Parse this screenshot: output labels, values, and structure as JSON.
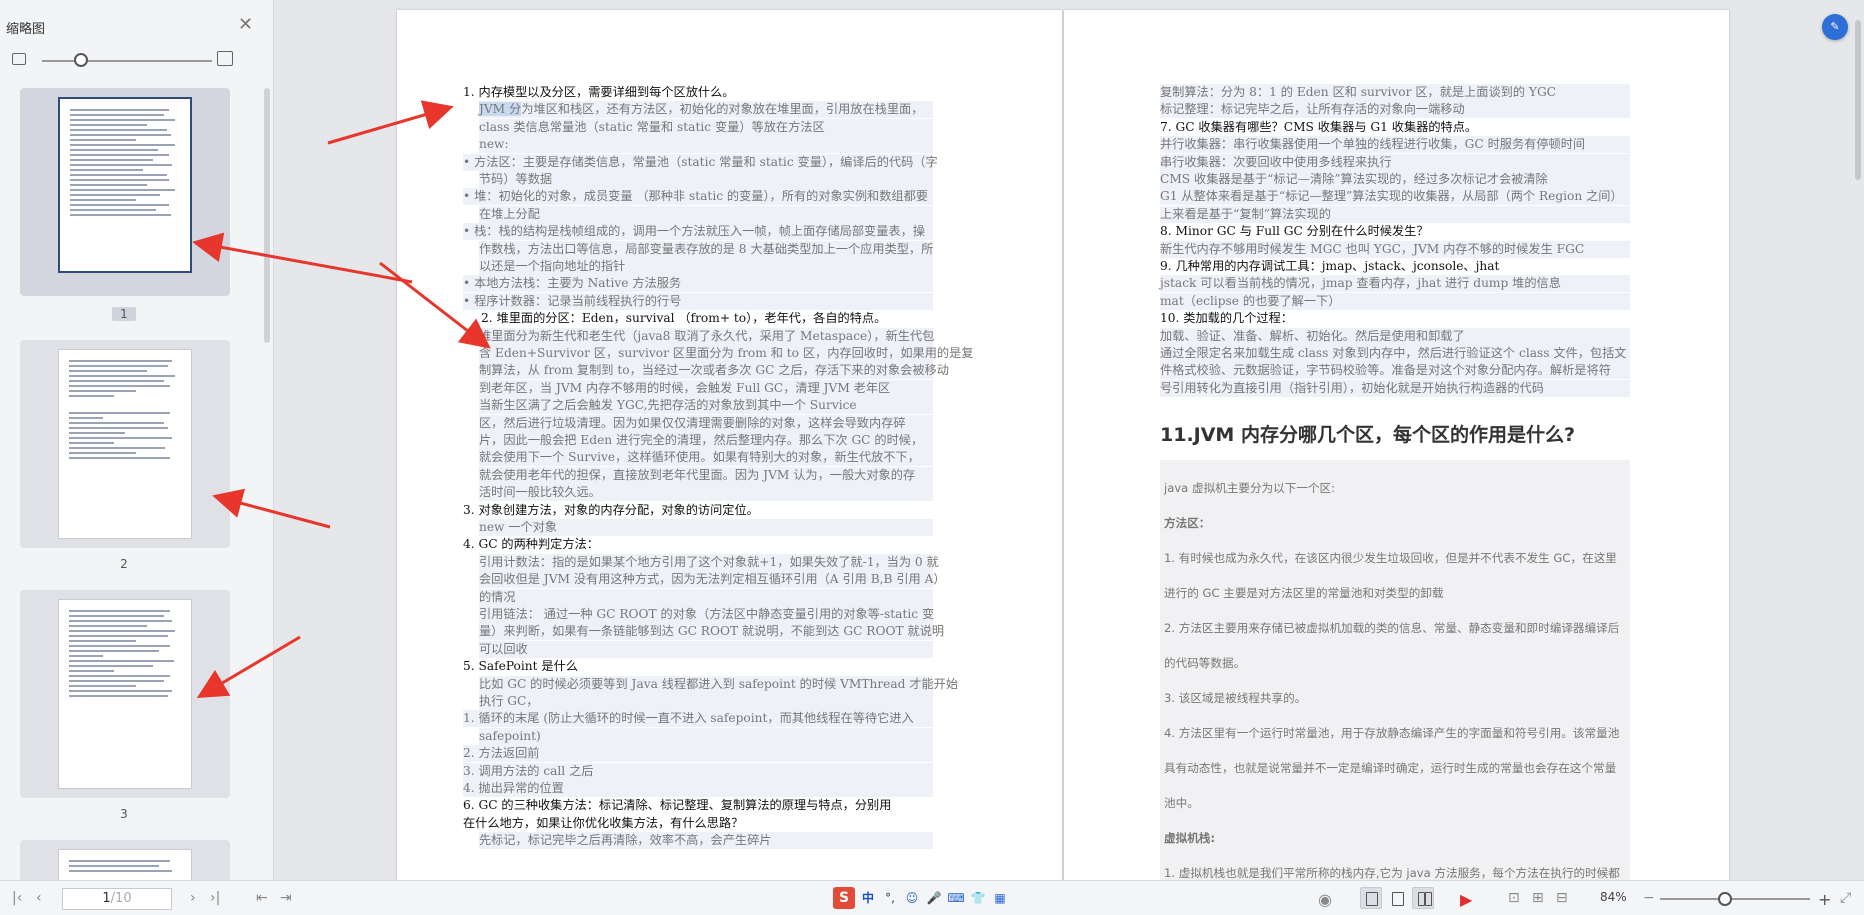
{
  "sidebar": {
    "title": "缩略图",
    "close_icon": "close-icon",
    "thumbnails": [
      {
        "label": "1",
        "selected": true
      },
      {
        "label": "2",
        "selected": false
      },
      {
        "label": "3",
        "selected": false
      }
    ]
  },
  "left_page": {
    "lines": [
      {
        "text": "1.  内存模型以及分区，需要详细到每个区放什么。",
        "kind": "h"
      },
      {
        "text": "JVM 分为堆区和栈区，还有方法区，初始化的对象放在堆里面，引用放在栈里面，",
        "kind": "b"
      },
      {
        "text": "class 类信息常量池（static 常量和 static 变量）等放在方法区",
        "kind": "b"
      },
      {
        "text": "new:",
        "kind": "b"
      },
      {
        "text": "•  方法区：主要是存储类信息，常量池（static 常量和 static 变量），编译后的代码（字",
        "kind": "b"
      },
      {
        "text": "节码）等数据",
        "kind": "b"
      },
      {
        "text": "•  堆：初始化的对象，成员变量 （那种非 static 的变量），所有的对象实例和数组都要",
        "kind": "b"
      },
      {
        "text": "在堆上分配",
        "kind": "b"
      },
      {
        "text": "•  栈：栈的结构是栈帧组成的，调用一个方法就压入一帧，帧上面存储局部变量表，操",
        "kind": "b"
      },
      {
        "text": "作数栈，方法出口等信息，局部变量表存放的是 8 大基础类型加上一个应用类型，所",
        "kind": "b"
      },
      {
        "text": "以还是一个指向地址的指针",
        "kind": "b"
      },
      {
        "text": "•  本地方法栈：主要为 Native 方法服务",
        "kind": "b"
      },
      {
        "text": "•  程序计数器：记录当前线程执行的行号",
        "kind": "b"
      },
      {
        "text": "2.  堆里面的分区：Eden，survival （from+ to），老年代，各自的特点。",
        "kind": "h"
      },
      {
        "text": "堆里面分为新生代和老生代（java8 取消了永久代，采用了 Metaspace），新生代包",
        "kind": "b"
      },
      {
        "text": "含 Eden+Survivor 区，survivor 区里面分为 from 和 to 区，内存回收时，如果用的是复",
        "kind": "b"
      },
      {
        "text": "制算法，从 from 复制到 to，当经过一次或者多次 GC 之后，存活下来的对象会被移动",
        "kind": "b"
      },
      {
        "text": "到老年区，当 JVM 内存不够用的时候，会触发 Full GC，清理 JVM 老年区",
        "kind": "b"
      },
      {
        "text": "当新生区满了之后会触发 YGC,先把存活的对象放到其中一个 Survice",
        "kind": "b"
      },
      {
        "text": "区，然后进行垃圾清理。因为如果仅仅清理需要删除的对象，这样会导致内存碎",
        "kind": "b"
      },
      {
        "text": "片，因此一般会把 Eden 进行完全的清理，然后整理内存。那么下次 GC 的时候，",
        "kind": "b"
      },
      {
        "text": "就会使用下一个 Survive，这样循环使用。如果有特别大的对象，新生代放不下，",
        "kind": "b"
      },
      {
        "text": "就会使用老年代的担保，直接放到老年代里面。因为 JVM 认为，一般大对象的存",
        "kind": "b"
      },
      {
        "text": "活时间一般比较久远。",
        "kind": "b"
      },
      {
        "text": "3.  对象创建方法，对象的内存分配，对象的访问定位。",
        "kind": "h"
      },
      {
        "text": "new 一个对象",
        "kind": "b"
      },
      {
        "text": "4.  GC 的两种判定方法：",
        "kind": "h"
      },
      {
        "text": "引用计数法：指的是如果某个地方引用了这个对象就+1，如果失效了就-1，当为 0 就",
        "kind": "b"
      },
      {
        "text": "会回收但是 JVM 没有用这种方式，因为无法判定相互循环引用（A 引用 B,B 引用 A）",
        "kind": "b"
      },
      {
        "text": "的情况",
        "kind": "b"
      },
      {
        "text": "引用链法： 通过一种 GC ROOT 的对象（方法区中静态变量引用的对象等-static 变",
        "kind": "b"
      },
      {
        "text": "量）来判断，如果有一条链能够到达 GC ROOT 就说明，不能到达 GC ROOT 就说明",
        "kind": "b"
      },
      {
        "text": "可以回收",
        "kind": "b"
      },
      {
        "text": "5.  SafePoint 是什么",
        "kind": "h"
      },
      {
        "text": "比如 GC 的时候必须要等到 Java 线程都进入到 safepoint 的时候 VMThread 才能开始",
        "kind": "b"
      },
      {
        "text": "执行 GC，",
        "kind": "b"
      },
      {
        "text": "1.  循环的末尾 (防止大循环的时候一直不进入 safepoint，而其他线程在等待它进入",
        "kind": "b"
      },
      {
        "text": "safepoint)",
        "kind": "b"
      },
      {
        "text": "2.  方法返回前",
        "kind": "b"
      },
      {
        "text": "3.  调用方法的 call 之后",
        "kind": "b"
      },
      {
        "text": "4.  抛出异常的位置",
        "kind": "b"
      },
      {
        "text": "6.  GC 的三种收集方法：标记清除、标记整理、复制算法的原理与特点，分别用",
        "kind": "h"
      },
      {
        "text": "在什么地方，如果让你优化收集方法，有什么思路？",
        "kind": "h"
      },
      {
        "text": "先标记，标记完毕之后再清除，效率不高，会产生碎片",
        "kind": "b"
      }
    ]
  },
  "right_page": {
    "lines": [
      {
        "text": "复制算法：分为 8：1 的 Eden 区和 survivor 区，就是上面谈到的 YGC",
        "kind": "b"
      },
      {
        "text": "标记整理：标记完毕之后，让所有存活的对象向一端移动",
        "kind": "b"
      },
      {
        "text": "7.  GC 收集器有哪些？CMS 收集器与 G1 收集器的特点。",
        "kind": "h"
      },
      {
        "text": "并行收集器：串行收集器使用一个单独的线程进行收集，GC 时服务有停顿时间",
        "kind": "b"
      },
      {
        "text": "串行收集器：次要回收中使用多线程来执行",
        "kind": "b"
      },
      {
        "text": "CMS 收集器是基于“标记—清除”算法实现的，经过多次标记才会被清除",
        "kind": "b"
      },
      {
        "text": "G1 从整体来看是基于“标记—整理”算法实现的收集器，从局部（两个 Region 之间）",
        "kind": "b"
      },
      {
        "text": "上来看是基于“复制”算法实现的",
        "kind": "b"
      },
      {
        "text": "8.  Minor GC 与 Full GC 分别在什么时候发生？",
        "kind": "h"
      },
      {
        "text": "新生代内存不够用时候发生 MGC 也叫 YGC，JVM 内存不够的时候发生 FGC",
        "kind": "b"
      },
      {
        "text": "9.  几种常用的内存调试工具：jmap、jstack、jconsole、jhat",
        "kind": "h"
      },
      {
        "text": "jstack 可以看当前栈的情况，jmap 查看内存，jhat 进行 dump 堆的信息",
        "kind": "b"
      },
      {
        "text": "mat（eclipse 的也要了解一下）",
        "kind": "b"
      },
      {
        "text": "10. 类加载的几个过程：",
        "kind": "h"
      },
      {
        "text": "加载、验证、准备、解析、初始化。然后是使用和卸载了",
        "kind": "b"
      },
      {
        "text": "通过全限定名来加载生成 class 对象到内存中，然后进行验证这个 class 文件，包括文",
        "kind": "b"
      },
      {
        "text": "件格式校验、元数据验证，字节码校验等。准备是对这个对象分配内存。解析是将符",
        "kind": "b"
      },
      {
        "text": "号引用转化为直接引用（指针引用），初始化就是开始执行构造器的代码",
        "kind": "b"
      }
    ],
    "heading": "11.JVM 内存分哪几个区，每个区的作用是什么?",
    "paras": [
      "java 虚拟机主要分为以下一个区:",
      "方法区：",
      "1. 有时候也成为永久代，在该区内很少发生垃圾回收，但是并不代表不发生 GC，在这里",
      "进行的 GC 主要是对方法区里的常量池和对类型的卸载",
      "2. 方法区主要用来存储已被虚拟机加载的类的信息、常量、静态变量和即时编译器编译后",
      "的代码等数据。",
      "3. 该区域是被线程共享的。",
      "4. 方法区里有一个运行时常量池，用于存放静态编译产生的字面量和符号引用。该常量池",
      "具有动态性，也就是说常量并不一定是编译时确定，运行时生成的常量也会存在这个常量",
      "池中。",
      "虚拟机栈:",
      "1. 虚拟机栈也就是我们平常所称的栈内存,它为 java 方法服务，每个方法在执行的时候都"
    ]
  },
  "status": {
    "page_current": "1",
    "page_total": "/10",
    "zoom": "84%",
    "ime": [
      "S",
      "中",
      "°,",
      "☺",
      "🎤",
      "⌨",
      "👕",
      "▦"
    ]
  }
}
